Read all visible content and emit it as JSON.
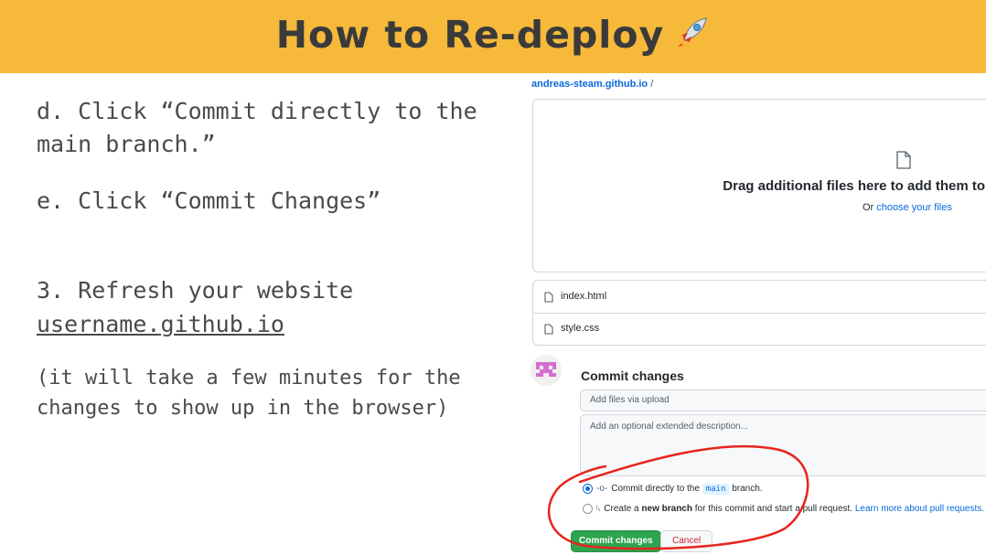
{
  "slide": {
    "title": "How to Re-deploy",
    "title_icon": "rocket-icon",
    "header_color": "#f6b93a"
  },
  "instructions": {
    "step_d_line1": "d. Click “Commit directly to the",
    "step_d_line2": "main branch.”",
    "step_e": "e. Click “Commit Changes”",
    "step_3_text": "3. Refresh your website",
    "step_3_link": "username.github.io",
    "note_line1": "(it will take a few minutes for the",
    "note_line2": "changes to show up in the browser)"
  },
  "github": {
    "breadcrumb_repo": "andreas-steam.github.io",
    "breadcrumb_sep": "/",
    "drop_title": "Drag additional files here to add them to",
    "drop_sub_prefix": "Or ",
    "drop_sub_link": "choose your files",
    "files": [
      "index.html",
      "style.css"
    ],
    "commit_title": "Commit changes",
    "summary_placeholder": "Add files via upload",
    "description_placeholder": "Add an optional extended description...",
    "option1_prefix": "Commit directly to the",
    "option1_branch": "main",
    "option1_suffix": "branch.",
    "option2_prefix": "Create a",
    "option2_bold": "new branch",
    "option2_suffix": "for this commit and start a pull request.",
    "option2_link": "Learn more about pull requests.",
    "commit_button": "Commit changes",
    "cancel_button": "Cancel",
    "colors": {
      "link": "#0969da",
      "commit_button": "#2da44e",
      "cancel_text": "#cf222e",
      "annotation": "#e8241c"
    }
  }
}
